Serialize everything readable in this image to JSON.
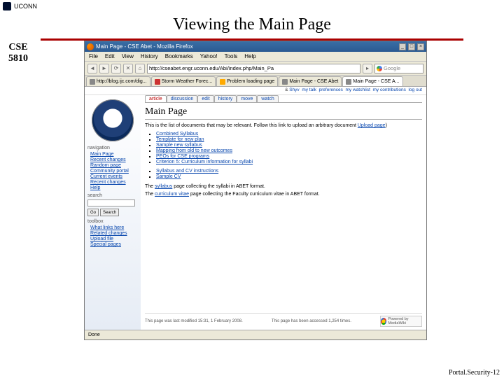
{
  "header": {
    "uconn": "UCONN",
    "slide_title": "Viewing the Main Page"
  },
  "left": {
    "line1": "CSE",
    "line2": "5810"
  },
  "browser": {
    "title": "Main Page - CSE Abet - Mozilla Firefox",
    "menus": [
      "File",
      "Edit",
      "View",
      "History",
      "Bookmarks",
      "Yahoo!",
      "Tools",
      "Help"
    ],
    "url": "http://cseabet.engr.uconn.edu/Abi/index.php/Main_Pa",
    "search_placeholder": "Google",
    "tabs": [
      {
        "label": "http://blog.ijc.com/dig..."
      },
      {
        "label": "Storm Weather Forec..."
      },
      {
        "label": "Problem loading page"
      },
      {
        "label": "Main Page - CSE Abet"
      },
      {
        "label": "Main Page - CSE A..."
      }
    ],
    "user_strip": {
      "user": "Shyv",
      "links": [
        "my talk",
        "preferences",
        "my watchlist",
        "my contributions",
        "log out"
      ],
      "ip_prefix": "& "
    },
    "page_tabs": [
      "article",
      "discussion",
      "edit",
      "history",
      "move",
      "watch"
    ],
    "page_title": "Main Page",
    "intro": "This is the list of documents that may be relevant. Follow this link to upload an arbitrary document ",
    "intro_link": "Upload page",
    "list1": [
      "Combined Syllabus",
      "Template for new plan",
      "Sample new syllabus",
      "Mapping from old to new outcomes",
      "PEOs for CSE programs",
      "Criterion 5: Curriculum information for syllabi"
    ],
    "list2": [
      "Syllabus and CV instructions",
      "Sample CV"
    ],
    "note1_a": "The ",
    "note1_link": "syllabus",
    "note1_b": " page collecting the syllabi in ABET format.",
    "note2_a": "The ",
    "note2_link": "curriculum vitae",
    "note2_b": " page collecting the Faculty curriculum vitae in ABET format.",
    "footer": {
      "modified": "This page was last modified 15:31, 1 February 2008.",
      "viewed": "This page has been accessed 1,254 times.",
      "badge": "Powered by MediaWiki"
    },
    "statusbar": "Done"
  },
  "sidebar": {
    "nav_label": "navigation",
    "nav": [
      "Main Page",
      "Recent changes",
      "Random page",
      "Community portal",
      "Current events",
      "Recent changes",
      "Help"
    ],
    "search_label": "search",
    "go": "Go",
    "search": "Search",
    "tools_label": "toolbox",
    "tools": [
      "What links here",
      "Related changes",
      "Upload file",
      "Special pages"
    ]
  },
  "slide_footer": "Portal.Security-12"
}
